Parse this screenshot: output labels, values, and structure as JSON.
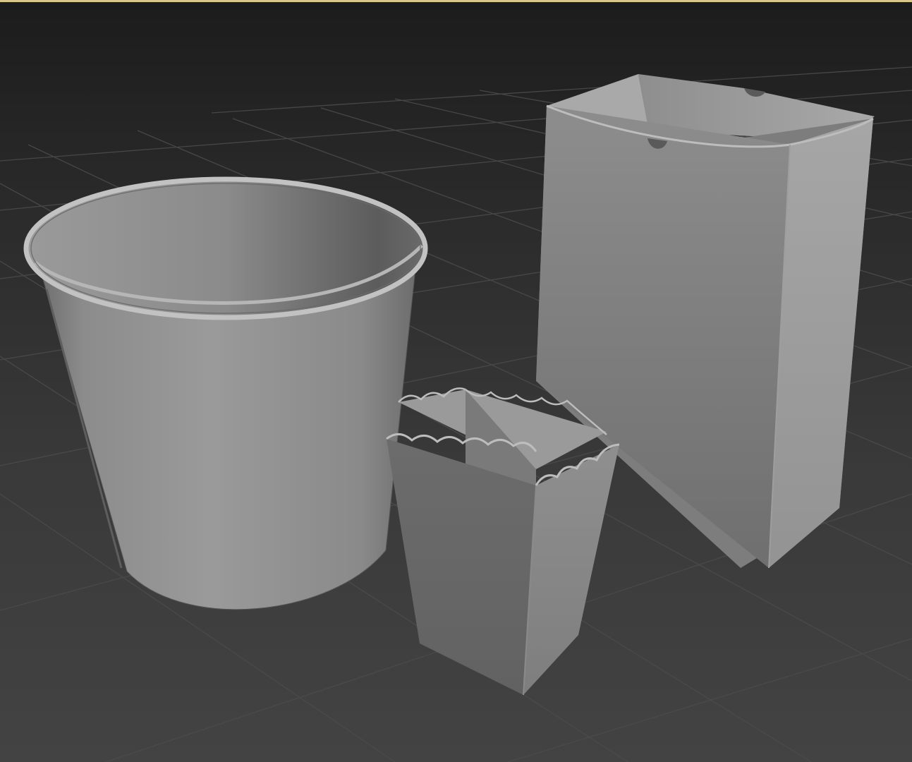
{
  "viewport": {
    "shading": "default-shading",
    "active_border_color": "#d8c98a",
    "background_top": "#1c1c1c",
    "background_bottom": "#434343",
    "grid_color": "#4a4a4a"
  },
  "scene": {
    "objects": [
      {
        "id": "large-bucket",
        "kind": "popcorn-bucket",
        "color": "#8a8a8a"
      },
      {
        "id": "small-scalloped-box",
        "kind": "popcorn-box",
        "color": "#7c7c7c"
      },
      {
        "id": "paper-bag",
        "kind": "popcorn-bag",
        "color": "#8f8f8f"
      }
    ]
  }
}
